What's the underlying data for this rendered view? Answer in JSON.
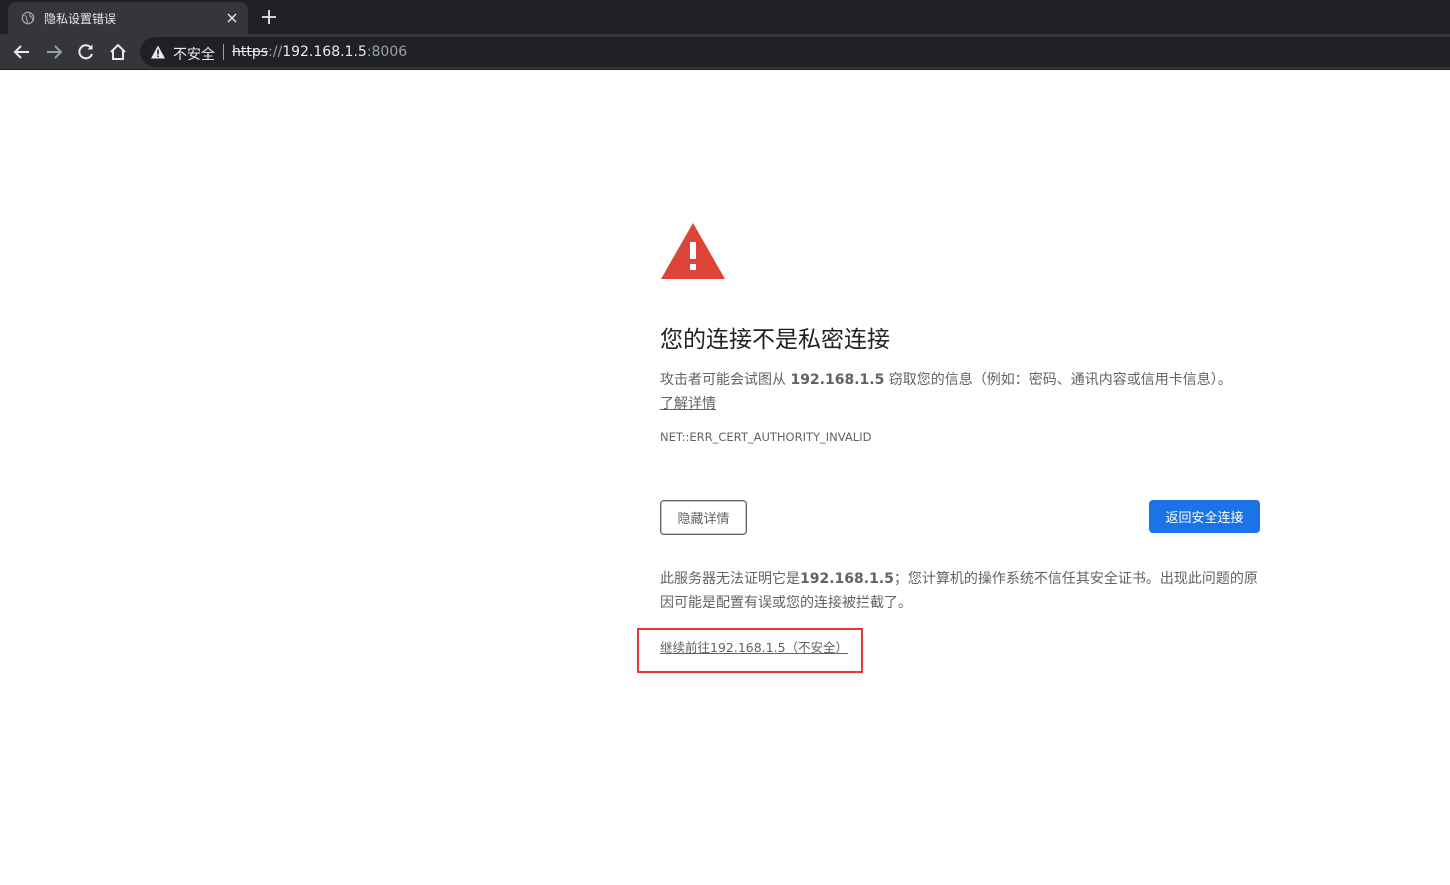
{
  "browser": {
    "tab": {
      "title": "隐私设置错误",
      "favicon": "globe-icon",
      "close_icon": "close-icon"
    },
    "new_tab_icon": "plus-icon",
    "nav": {
      "back_icon": "arrow-left-icon",
      "forward_icon": "arrow-right-icon",
      "reload_icon": "reload-icon",
      "home_icon": "home-icon"
    },
    "omnibox": {
      "security_icon": "warning-triangle-icon",
      "security_label": "不安全",
      "url_scheme": "https",
      "url_separator": "://",
      "url_host": "192.168.1.5",
      "url_port": ":8006"
    }
  },
  "page": {
    "warning_icon": "warning-triangle-icon",
    "heading": "您的连接不是私密连接",
    "primary": {
      "before": "攻击者可能会试图从 ",
      "host": "192.168.1.5",
      "after": " 窃取您的信息（例如：密码、通讯内容或信用卡信息）。",
      "learn_more": "了解详情"
    },
    "error_code": "NET::ERR_CERT_AUTHORITY_INVALID",
    "buttons": {
      "hide_details": "隐藏详情",
      "back_to_safety": "返回安全连接"
    },
    "details": {
      "before": "此服务器无法证明它是",
      "host": "192.168.1.5",
      "after": "；您计算机的操作系统不信任其安全证书。出现此问题的原因可能是配置有误或您的连接被拦截了。"
    },
    "proceed_link": "继续前往192.168.1.5（不安全）"
  },
  "colors": {
    "warning_red": "#db4437",
    "primary_blue": "#1a73e8",
    "highlight_red": "#e53935",
    "chrome_dark": "#202124",
    "chrome_toolbar": "#35363a"
  }
}
